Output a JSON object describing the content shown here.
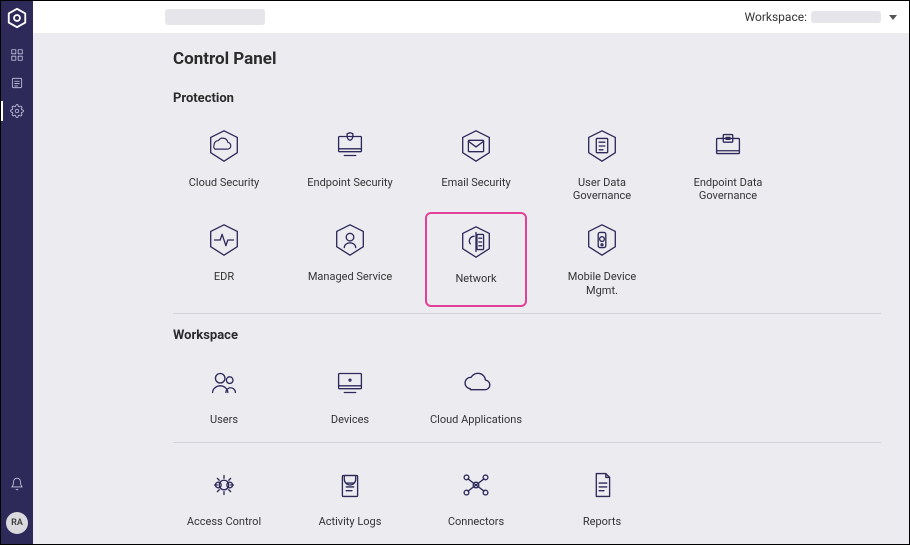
{
  "topbar": {
    "workspace_label": "Workspace:"
  },
  "sidebar": {
    "avatar_initials": "RA"
  },
  "page": {
    "title": "Control Panel"
  },
  "sections": {
    "protection": {
      "title": "Protection",
      "tiles": [
        {
          "label": "Cloud Security"
        },
        {
          "label": "Endpoint Security"
        },
        {
          "label": "Email Security"
        },
        {
          "label": "User Data Governance"
        },
        {
          "label": "Endpoint Data Governance"
        },
        {
          "label": "EDR"
        },
        {
          "label": "Managed Service"
        },
        {
          "label": "Network"
        },
        {
          "label": "Mobile Device Mgmt."
        }
      ]
    },
    "workspace": {
      "title": "Workspace",
      "tiles": [
        {
          "label": "Users"
        },
        {
          "label": "Devices"
        },
        {
          "label": "Cloud Applications"
        },
        {
          "label": "Access Control"
        },
        {
          "label": "Activity Logs"
        },
        {
          "label": "Connectors"
        },
        {
          "label": "Reports"
        }
      ]
    }
  }
}
